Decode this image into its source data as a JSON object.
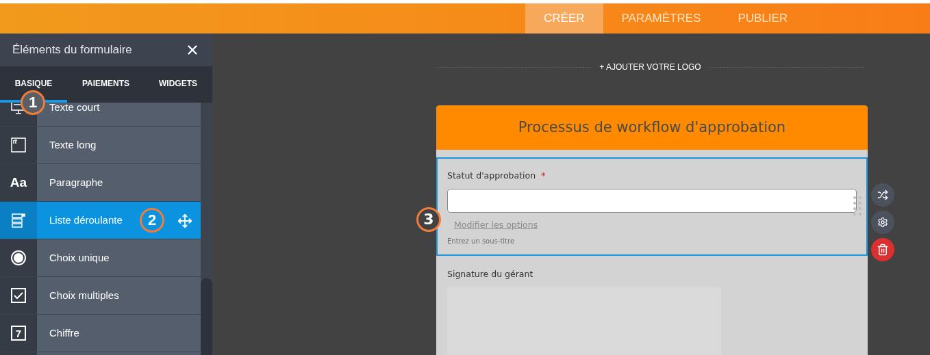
{
  "top_nav": {
    "tabs": [
      {
        "label": "CRÉER",
        "selected": true
      },
      {
        "label": "PARAMÈTRES",
        "selected": false
      },
      {
        "label": "PUBLIER",
        "selected": false
      }
    ]
  },
  "sidebar": {
    "title": "Éléments du formulaire",
    "tabs": [
      {
        "label": "BASIQUE",
        "selected": true
      },
      {
        "label": "PAIEMENTS",
        "selected": false
      },
      {
        "label": "WIDGETS",
        "selected": false
      }
    ],
    "items": [
      {
        "label": "Texte court",
        "kind": "short-text",
        "selected": false
      },
      {
        "label": "Texte long",
        "kind": "long-text",
        "selected": false
      },
      {
        "label": "Paragraphe",
        "kind": "paragraph",
        "glyph": "Aa",
        "selected": false
      },
      {
        "label": "Liste déroulante",
        "kind": "dropdown",
        "selected": true
      },
      {
        "label": "Choix unique",
        "kind": "radio",
        "selected": false
      },
      {
        "label": "Choix multiples",
        "kind": "checkbox",
        "selected": false
      },
      {
        "label": "Chiffre",
        "kind": "number",
        "glyph": "7",
        "selected": false
      }
    ]
  },
  "canvas": {
    "add_logo": "+ AJOUTER VOTRE LOGO",
    "form": {
      "title": "Processus de workflow d'approbation",
      "fields": [
        {
          "kind": "dropdown",
          "label": "Statut d'approbation",
          "required_mark": "*",
          "selected": true,
          "edit_options": "Modifier les options",
          "subtitle_placeholder": "Entrez un sous-titre"
        },
        {
          "kind": "signature",
          "label": "Signature du gérant",
          "selected": false
        }
      ]
    }
  },
  "callouts": [
    {
      "number": "1"
    },
    {
      "number": "2"
    },
    {
      "number": "3"
    }
  ]
}
